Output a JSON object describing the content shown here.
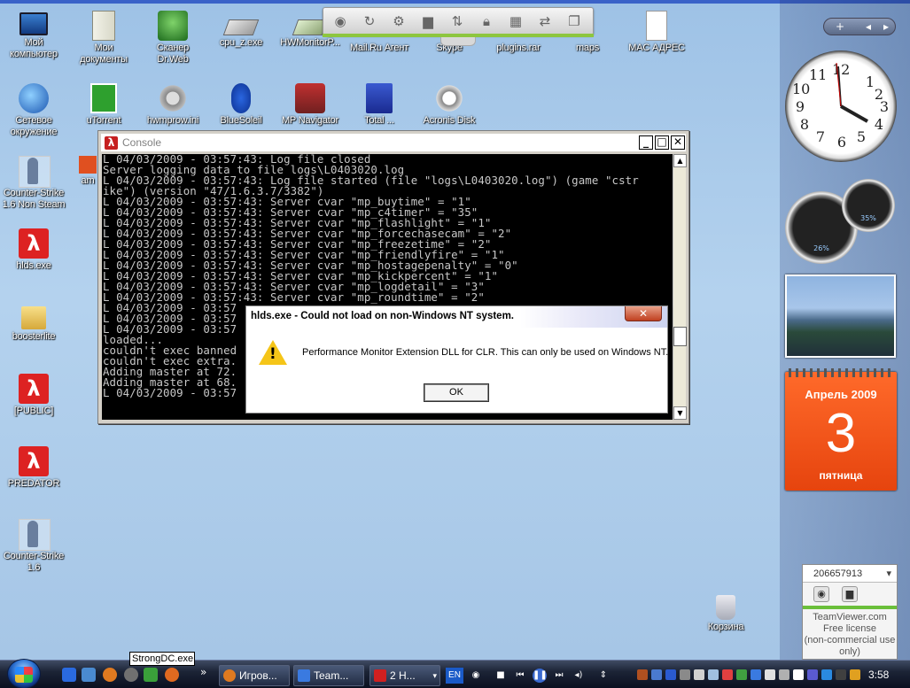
{
  "desktop": {
    "icons": [
      {
        "label": "Мой\nкомпьютер"
      },
      {
        "label": "Мои\nдокументы"
      },
      {
        "label": "Сканер\nDr.Web"
      },
      {
        "label": "cpu_z.exe"
      },
      {
        "label": "HWMonitorP..."
      },
      {
        "label": "Mail.Ru Агент"
      },
      {
        "label": "Skype"
      },
      {
        "label": "plugins.rar"
      },
      {
        "label": "maps"
      },
      {
        "label": "MAC АДРЕС"
      },
      {
        "label": "Сетевое\nокружение"
      },
      {
        "label": "uTorrent"
      },
      {
        "label": "hwmprow.ini"
      },
      {
        "label": "BlueSoleil"
      },
      {
        "label": "MP Navigator"
      },
      {
        "label": "Total ..."
      },
      {
        "label": "Acronis Disk"
      },
      {
        "label": "Counter-Strike\n1.6 Non Steam"
      },
      {
        "label": "am"
      },
      {
        "label": "hlds.exe"
      },
      {
        "label": "boosterlite"
      },
      {
        "label": "[PUBLIC]"
      },
      {
        "label": "PREDATOR"
      },
      {
        "label": "Counter-Strike\n1.6"
      },
      {
        "label": "Корзина"
      }
    ]
  },
  "console": {
    "title": "Console",
    "lines": [
      "L 04/03/2009 - 03:57:43: Log file closed",
      "Server logging data to file logs\\L0403020.log",
      "L 04/03/2009 - 03:57:43: Log file started (file \"logs\\L0403020.log\") (game \"cstr",
      "ike\") (version \"47/1.6.3.7/3382\")",
      "L 04/03/2009 - 03:57:43: Server cvar \"mp_buytime\" = \"1\"",
      "L 04/03/2009 - 03:57:43: Server cvar \"mp_c4timer\" = \"35\"",
      "L 04/03/2009 - 03:57:43: Server cvar \"mp_flashlight\" = \"1\"",
      "L 04/03/2009 - 03:57:43: Server cvar \"mp_forcechasecam\" = \"2\"",
      "L 04/03/2009 - 03:57:43: Server cvar \"mp_freezetime\" = \"2\"",
      "L 04/03/2009 - 03:57:43: Server cvar \"mp_friendlyfire\" = \"1\"",
      "L 04/03/2009 - 03:57:43: Server cvar \"mp_hostagepenalty\" = \"0\"",
      "L 04/03/2009 - 03:57:43: Server cvar \"mp_kickpercent\" = \"1\"",
      "L 04/03/2009 - 03:57:43: Server cvar \"mp_logdetail\" = \"3\"",
      "L 04/03/2009 - 03:57:43: Server cvar \"mp_roundtime\" = \"2\"",
      "L 04/03/2009 - 03:57",
      "L 04/03/2009 - 03:57",
      "L 04/03/2009 - 03:57",
      "loaded...",
      "couldn't exec banned",
      "couldn't exec extra.",
      "Adding master at 72.",
      "Adding master at 68.",
      "L 04/03/2009 - 03:57"
    ]
  },
  "dialog": {
    "title": "hlds.exe - Could not load on non-Windows NT system.",
    "message": "Performance Monitor Extension DLL for CLR.  This can only be used on Windows NT.",
    "ok_label": "OK",
    "close_glyph": "✕"
  },
  "toolbar": {
    "buttons": [
      "record-icon",
      "refresh-icon",
      "gear-icon",
      "chat-icon",
      "transfer-icon",
      "lock-icon",
      "grid-icon",
      "swap-icon",
      "windows-icon"
    ]
  },
  "sidebar": {
    "clock": {
      "time_shown": "3:58"
    },
    "gauges": {
      "cpu": "26%",
      "ram": "35%"
    },
    "calendar": {
      "month": "Апрель 2009",
      "day": "3",
      "weekday": "пятница"
    }
  },
  "teamviewer": {
    "id": "206657913",
    "line1": "TeamViewer.com",
    "line2": "Free license",
    "line3": "(non-commercial use",
    "line4": "only)"
  },
  "taskbar": {
    "tooltip": "StrongDC.exe",
    "buttons": [
      {
        "label": "Игров..."
      },
      {
        "label": "Team..."
      },
      {
        "label": "2 Н..."
      }
    ],
    "lang": "EN",
    "chevron": "»",
    "clock": "3:58"
  },
  "colors": {
    "desktop": "#a8c8e8",
    "console_bg": "#000000",
    "calendar": "#f0561c",
    "tv_green": "#6abf3a"
  }
}
